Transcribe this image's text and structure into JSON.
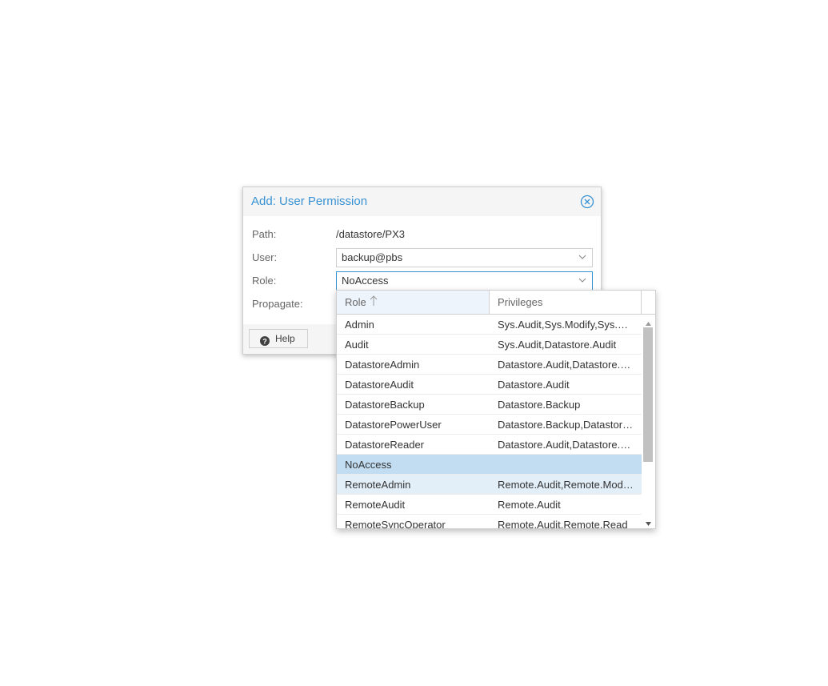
{
  "dialog": {
    "title": "Add: User Permission",
    "close_icon": "close-circle-icon",
    "fields": {
      "path_label": "Path:",
      "path_value": "/datastore/PX3",
      "user_label": "User:",
      "user_value": "backup@pbs",
      "role_label": "Role:",
      "role_value": "NoAccess",
      "propagate_label": "Propagate:"
    },
    "footer": {
      "help_label": "Help",
      "help_icon": "question-circle-icon"
    }
  },
  "picker": {
    "columns": {
      "role": "Role",
      "privileges": "Privileges"
    },
    "sort": "role-ascending",
    "selected": "NoAccess",
    "hovered": "RemoteAdmin",
    "rows": [
      {
        "role": "Admin",
        "privileges": "Sys.Audit,Sys.Modify,Sys.…"
      },
      {
        "role": "Audit",
        "privileges": "Sys.Audit,Datastore.Audit"
      },
      {
        "role": "DatastoreAdmin",
        "privileges": "Datastore.Audit,Datastore.…"
      },
      {
        "role": "DatastoreAudit",
        "privileges": "Datastore.Audit"
      },
      {
        "role": "DatastoreBackup",
        "privileges": "Datastore.Backup"
      },
      {
        "role": "DatastorePowerUser",
        "privileges": "Datastore.Backup,Datastor…"
      },
      {
        "role": "DatastoreReader",
        "privileges": "Datastore.Audit,Datastore.…"
      },
      {
        "role": "NoAccess",
        "privileges": ""
      },
      {
        "role": "RemoteAdmin",
        "privileges": "Remote.Audit,Remote.Mod…"
      },
      {
        "role": "RemoteAudit",
        "privileges": "Remote.Audit"
      },
      {
        "role": "RemoteSyncOperator",
        "privileges": "Remote.Audit,Remote.Read"
      }
    ]
  },
  "colors": {
    "accent": "#3892d4",
    "selected_row": "#c2ddf2",
    "hover_row": "#e2eff9"
  }
}
